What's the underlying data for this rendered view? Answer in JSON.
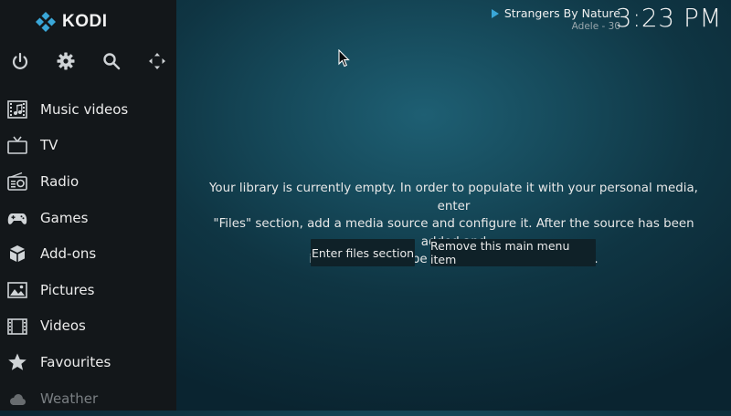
{
  "app": {
    "name": "KODI"
  },
  "top_icons": [
    "power-icon",
    "gear-icon",
    "search-icon",
    "fullscreen-icon"
  ],
  "menu": {
    "items": [
      {
        "label": "Music videos",
        "icon": "music-video-icon"
      },
      {
        "label": "TV",
        "icon": "tv-icon"
      },
      {
        "label": "Radio",
        "icon": "radio-icon"
      },
      {
        "label": "Games",
        "icon": "gamepad-icon"
      },
      {
        "label": "Add-ons",
        "icon": "addons-box-icon"
      },
      {
        "label": "Pictures",
        "icon": "pictures-icon"
      },
      {
        "label": "Videos",
        "icon": "film-icon"
      },
      {
        "label": "Favourites",
        "icon": "star-icon"
      },
      {
        "label": "Weather",
        "icon": "weather-icon"
      }
    ]
  },
  "now_playing": {
    "title": "Strangers By Nature",
    "subtitle": "Adele - 30"
  },
  "clock": "3:23 PM",
  "main": {
    "message_line1": "Your library is currently empty. In order to populate it with your personal media, enter",
    "message_line2": "\"Files\" section, add a media source and configure it. After the source has been added and",
    "message_line3": "indexed you will be able to browse your library.",
    "btn_enter_files": "Enter files section",
    "btn_remove_item": "Remove this main menu item"
  },
  "colors": {
    "sidebar_bg": "#13171a",
    "accent": "#3aa7d8",
    "button_bg": "#0f2128"
  }
}
